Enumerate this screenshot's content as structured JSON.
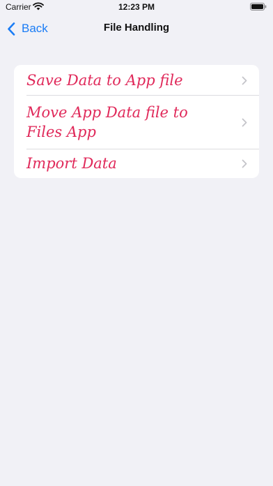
{
  "status_bar": {
    "carrier": "Carrier",
    "time": "12:23 PM",
    "wifi_icon": "wifi-icon",
    "battery_icon": "battery-icon"
  },
  "nav": {
    "back_label": "Back",
    "back_icon": "chevron-left-icon",
    "title": "File Handling"
  },
  "menu": {
    "items": [
      {
        "label": "Save Data to App file",
        "icon": "chevron-right-icon"
      },
      {
        "label": "Move App Data file to Files App",
        "icon": "chevron-right-icon"
      },
      {
        "label": "Import Data",
        "icon": "chevron-right-icon"
      }
    ]
  },
  "colors": {
    "accent": "#1a7cf5",
    "item_text": "#e0295a",
    "background": "#f1f1f6",
    "card": "#ffffff"
  }
}
